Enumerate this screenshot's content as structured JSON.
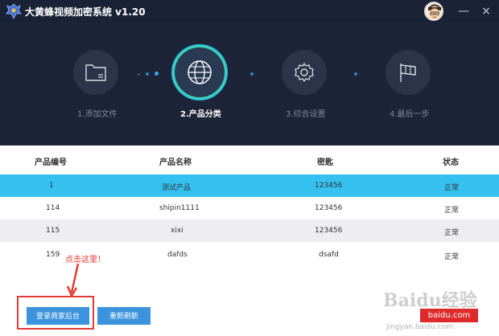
{
  "titlebar": {
    "title": "大黄蜂视频加密系统 v1.20",
    "minimize_icon": "—",
    "close_icon": "×"
  },
  "steps": [
    {
      "label": "1.添加文件",
      "icon": "folder-icon",
      "active": false
    },
    {
      "label": "2.产品分类",
      "icon": "globe-icon",
      "active": true
    },
    {
      "label": "3.综合设置",
      "icon": "gear-icon",
      "active": false
    },
    {
      "label": "4.最后一步",
      "icon": "flag-icon",
      "active": false
    }
  ],
  "table": {
    "headers": [
      "产品编号",
      "产品名称",
      "密匙",
      "状态"
    ],
    "rows": [
      {
        "id": "1",
        "name": "测试产品",
        "key": "123456",
        "status": "正常"
      },
      {
        "id": "114",
        "name": "shipin1111",
        "key": "123456",
        "status": "正常"
      },
      {
        "id": "115",
        "name": "xixi",
        "key": "123456",
        "status": "正常"
      },
      {
        "id": "159",
        "name": "dafds",
        "key": "dsafd",
        "status": "正常"
      }
    ]
  },
  "buttons": {
    "login": "登录商家后台",
    "refresh": "重新刷新"
  },
  "annotation": "点击这里！",
  "watermark": {
    "text": "Baidu经验",
    "badge": "baidu.com",
    "sub": "jingyan.baidu.com"
  },
  "colors": {
    "header_bg": "#1d2438",
    "selected_row": "#35c1f0",
    "button": "#3a93dc",
    "annotation": "#e23b33"
  }
}
